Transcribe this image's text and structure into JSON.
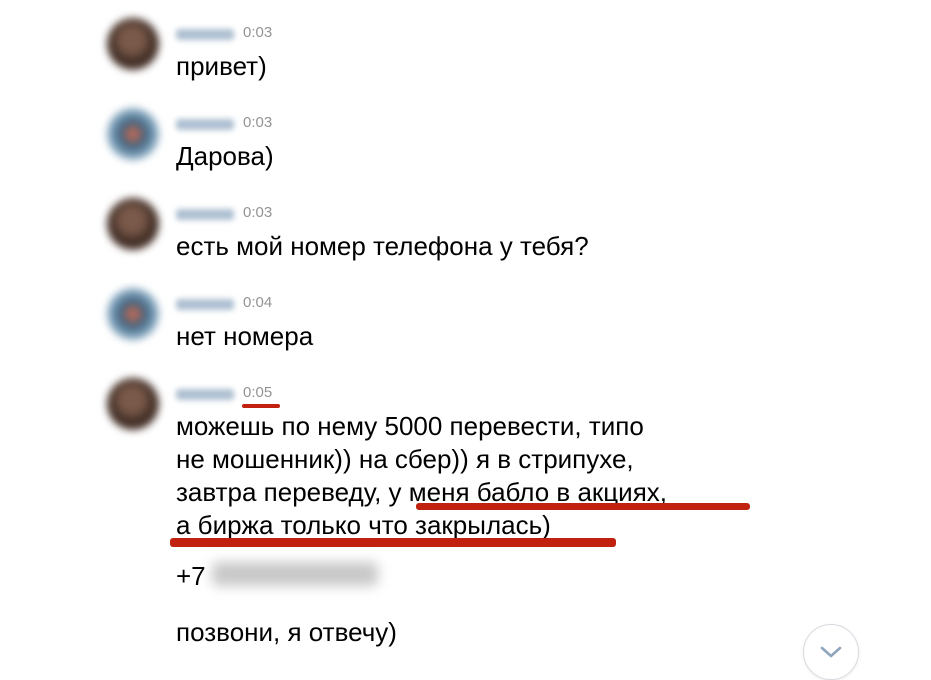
{
  "messages": [
    {
      "time": "0:03",
      "text": "привет)"
    },
    {
      "time": "0:03",
      "text": "Дарова)"
    },
    {
      "time": "0:03",
      "text": "есть мой номер телефона у тебя?"
    },
    {
      "time": "0:04",
      "text": "нет номера"
    },
    {
      "time": "0:05",
      "lines": [
        "можешь по нему 5000 перевести, типо",
        "не мошенник)) на сбер)) я в стрипухе,",
        "завтра переведу, у меня бабло в акциях,",
        "а биржа только что закрылась)"
      ],
      "phone_prefix": "+7",
      "followup": "позвони, я отвечу)"
    }
  ],
  "colors": {
    "highlight_underline": "#c0220f",
    "timestamp": "#939393"
  },
  "icons": {
    "scroll_down": "chevron-down-icon"
  }
}
